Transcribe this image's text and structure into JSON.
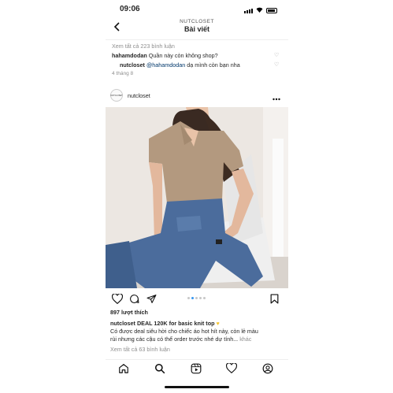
{
  "status": {
    "time": "09:06"
  },
  "header": {
    "subtitle": "NUTCLOSET",
    "title": "Bài viết",
    "back_icon": "chevron-left-icon"
  },
  "comments": {
    "view_all_top": "Xem tất cả 223 bình luận",
    "items": [
      {
        "user": "hahamdodan",
        "text": "Quần này còn không shop?"
      },
      {
        "user": "nutcloset",
        "mention": "@hahamdodan",
        "text": "dạ mình còn bạn nha"
      }
    ],
    "date": "4 tháng 8"
  },
  "post": {
    "username": "nutcloset",
    "avatar_text": "NUTCLOSET",
    "more_icon": "more-horizontal-icon",
    "likes": "897 lượt thích",
    "caption_user": "nutcloset",
    "caption_title": "DEAL 120K for basic knit top",
    "caption_emoji": "💛",
    "caption_line1": "Có được deal siêu hời cho chiếc áo hot hít này, còn lẻ màu",
    "caption_line2": "rùi nhưng các cậu có thể order trước nhé dự tính...",
    "more_label": "khác",
    "view_all_bottom": "Xem tất cả 63 bình luận",
    "carousel": {
      "count": 5,
      "active": 1
    }
  },
  "colors": {
    "accent": "#3897f0",
    "text": "#262626",
    "muted": "#8e8e8e",
    "link": "#00376b",
    "heart_yellow": "#f4c430"
  },
  "nav": [
    "home-icon",
    "search-icon",
    "reels-icon",
    "heart-icon",
    "profile-icon"
  ]
}
